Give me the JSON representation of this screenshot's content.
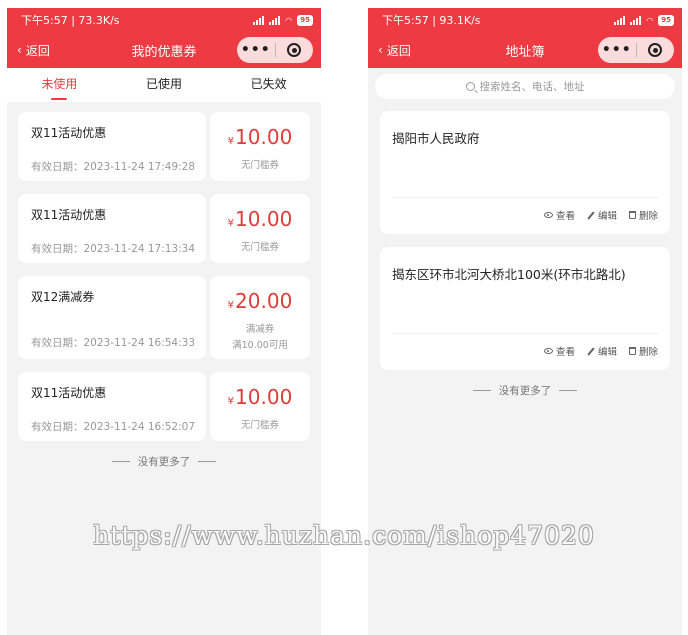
{
  "left": {
    "status": {
      "time": "下午5:57 | 73.3K/s",
      "battery": "95"
    },
    "nav": {
      "back_label": "返回",
      "title": "我的优惠券",
      "more": "•••"
    },
    "tabs": [
      "未使用",
      "已使用",
      "已失效"
    ],
    "coupons": [
      {
        "name": "双11活动优惠",
        "date": "有效日期：2023-11-24 17:49:28",
        "yen": "¥",
        "amount": "10.00",
        "type": "无门槛券",
        "cond": ""
      },
      {
        "name": "双11活动优惠",
        "date": "有效日期：2023-11-24 17:13:34",
        "yen": "¥",
        "amount": "10.00",
        "type": "无门槛券",
        "cond": ""
      },
      {
        "name": "双12满减券",
        "date": "有效日期：2023-11-24 16:54:33",
        "yen": "¥",
        "amount": "20.00",
        "type": "满减券",
        "cond": "满10.00可用"
      },
      {
        "name": "双11活动优惠",
        "date": "有效日期：2023-11-24 16:52:07",
        "yen": "¥",
        "amount": "10.00",
        "type": "无门槛券",
        "cond": ""
      }
    ],
    "end_note": "没有更多了"
  },
  "right": {
    "status": {
      "time": "下午5:57 | 93.1K/s",
      "battery": "95"
    },
    "nav": {
      "back_label": "返回",
      "title": "地址簿",
      "more": "•••"
    },
    "search": {
      "placeholder": "搜索姓名、电话、地址"
    },
    "addresses": [
      {
        "name": "揭阳市人民政府",
        "view": "查看",
        "edit": "编辑",
        "delete": "删除"
      },
      {
        "name": "揭东区环市北河大桥北100米(环市北路北)",
        "view": "查看",
        "edit": "编辑",
        "delete": "删除"
      }
    ],
    "end_note": "没有更多了"
  },
  "watermark": "https://www.huzhan.com/ishop47020",
  "colors": {
    "accent": "#ee3b43",
    "price": "#e03c3c"
  }
}
